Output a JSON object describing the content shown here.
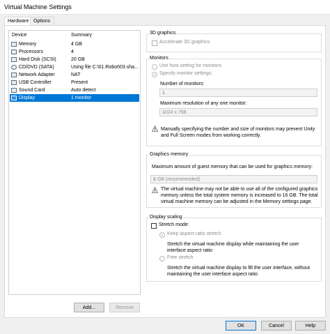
{
  "window": {
    "title": "Virtual Machine Settings"
  },
  "tabs": [
    "Hardware",
    "Options"
  ],
  "device_list": {
    "col_device": "Device",
    "col_summary": "Summary",
    "rows": [
      {
        "device": "Memory",
        "summary": "4 GB",
        "icon": "memory-icon"
      },
      {
        "device": "Processors",
        "summary": "4",
        "icon": "processor-icon"
      },
      {
        "device": "Hard Disk (SCSI)",
        "summary": "20 GB",
        "icon": "hard-disk-icon"
      },
      {
        "device": "CD/DVD (SATA)",
        "summary": "Using file C:\\01.Robot\\03.sha...",
        "icon": "cd-dvd-icon"
      },
      {
        "device": "Network Adapter",
        "summary": "NAT",
        "icon": "network-adapter-icon"
      },
      {
        "device": "USB Controller",
        "summary": "Present",
        "icon": "usb-icon"
      },
      {
        "device": "Sound Card",
        "summary": "Auto detect",
        "icon": "sound-card-icon"
      },
      {
        "device": "Display",
        "summary": "1 monitor",
        "icon": "display-icon",
        "selected": true
      }
    ],
    "add_label": "Add...",
    "remove_label": "Remove"
  },
  "graphics_3d": {
    "title": "3D graphics",
    "accelerate_label": "Accelerate 3D graphics"
  },
  "monitors": {
    "title": "Monitors",
    "use_host_label": "Use host setting for monitors",
    "specify_label": "Specify monitor settings:",
    "num_label": "Number of monitors:",
    "num_value": "1",
    "res_label": "Maximum resolution of any one monitor:",
    "res_value": "1024 x 768",
    "warning": "Manually specifying the number and size of monitors may prevent Unity and Full Screen modes from working correctly."
  },
  "graphics_memory": {
    "title": "Graphics memory",
    "label": "Maximum amount of guest memory that can be used for graphics memory:",
    "value": "8 GB (recommended)",
    "warning": "The virtual machine may not be able to use all of the configured graphics memory unless the total system memory is increased to 16 GB. The total virtual machine memory can be adjusted in the Memory settings page."
  },
  "display_scaling": {
    "title": "Display scaling",
    "stretch_label": "Stretch mode:",
    "keep_label": "Keep aspect ratio stretch",
    "keep_desc": "Stretch the virtual machine display while maintaining the user interface aspect ratio",
    "free_label": "Free stretch",
    "free_desc": "Stretch the virtual machine display to fill the user interface, without maintaining the user interface aspect ratio"
  },
  "footer": {
    "ok": "OK",
    "cancel": "Cancel",
    "help": "Help"
  }
}
